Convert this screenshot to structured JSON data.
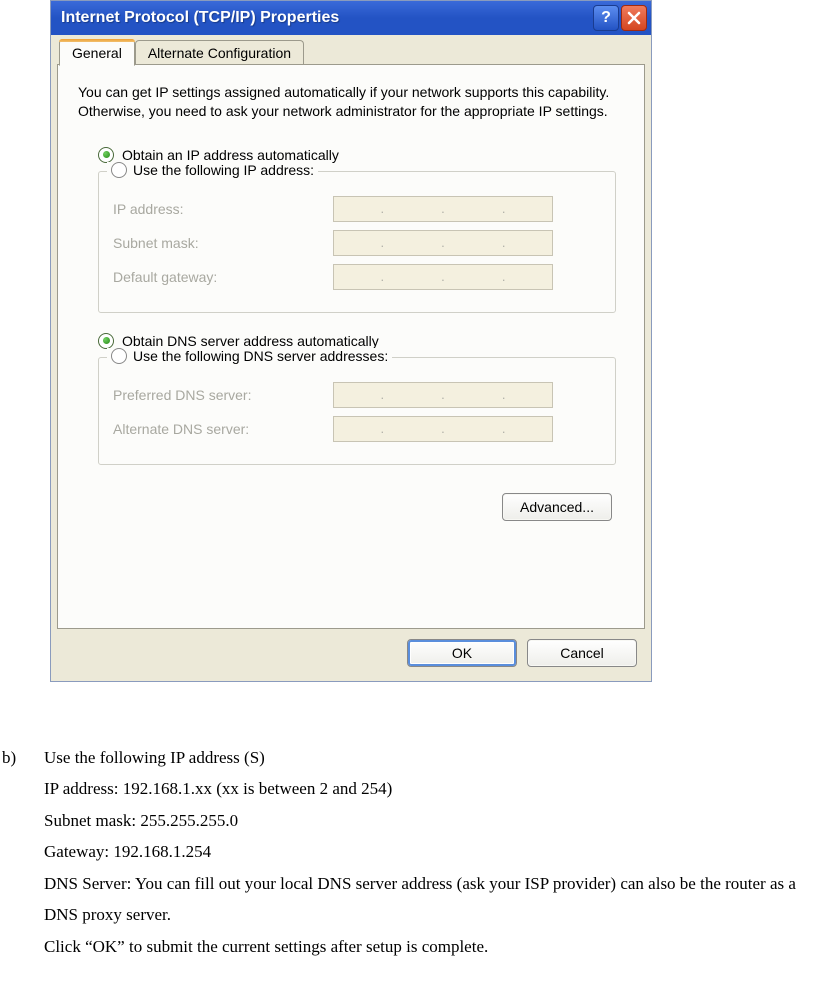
{
  "dialog": {
    "title": "Internet Protocol (TCP/IP) Properties",
    "tabs": {
      "general": "General",
      "alternate": "Alternate Configuration"
    },
    "description": "You can get IP settings assigned automatically if your network supports this capability. Otherwise, you need to ask your network administrator for the appropriate IP settings.",
    "ip": {
      "auto_label": "Obtain an IP address automatically",
      "manual_label": "Use the following IP address:",
      "ip_address_label": "IP address:",
      "subnet_label": "Subnet mask:",
      "gateway_label": "Default gateway:"
    },
    "dns": {
      "auto_label": "Obtain DNS server address automatically",
      "manual_label": "Use the following DNS server addresses:",
      "preferred_label": "Preferred DNS server:",
      "alternate_label": "Alternate DNS server:"
    },
    "advanced_button": "Advanced...",
    "ok_button": "OK",
    "cancel_button": "Cancel",
    "dot": "."
  },
  "instructions": {
    "marker": "b)",
    "line1": "Use the following IP address (S)",
    "line2": "IP address: 192.168.1.xx (xx is between 2 and 254)",
    "line3": "Subnet mask: 255.255.255.0",
    "line4": "Gateway: 192.168.1.254",
    "line5": "DNS Server: You can fill out your local DNS server address (ask your ISP provider) can also be the router as a DNS proxy server.",
    "line6": "Click “OK” to submit the current settings after setup is complete."
  }
}
